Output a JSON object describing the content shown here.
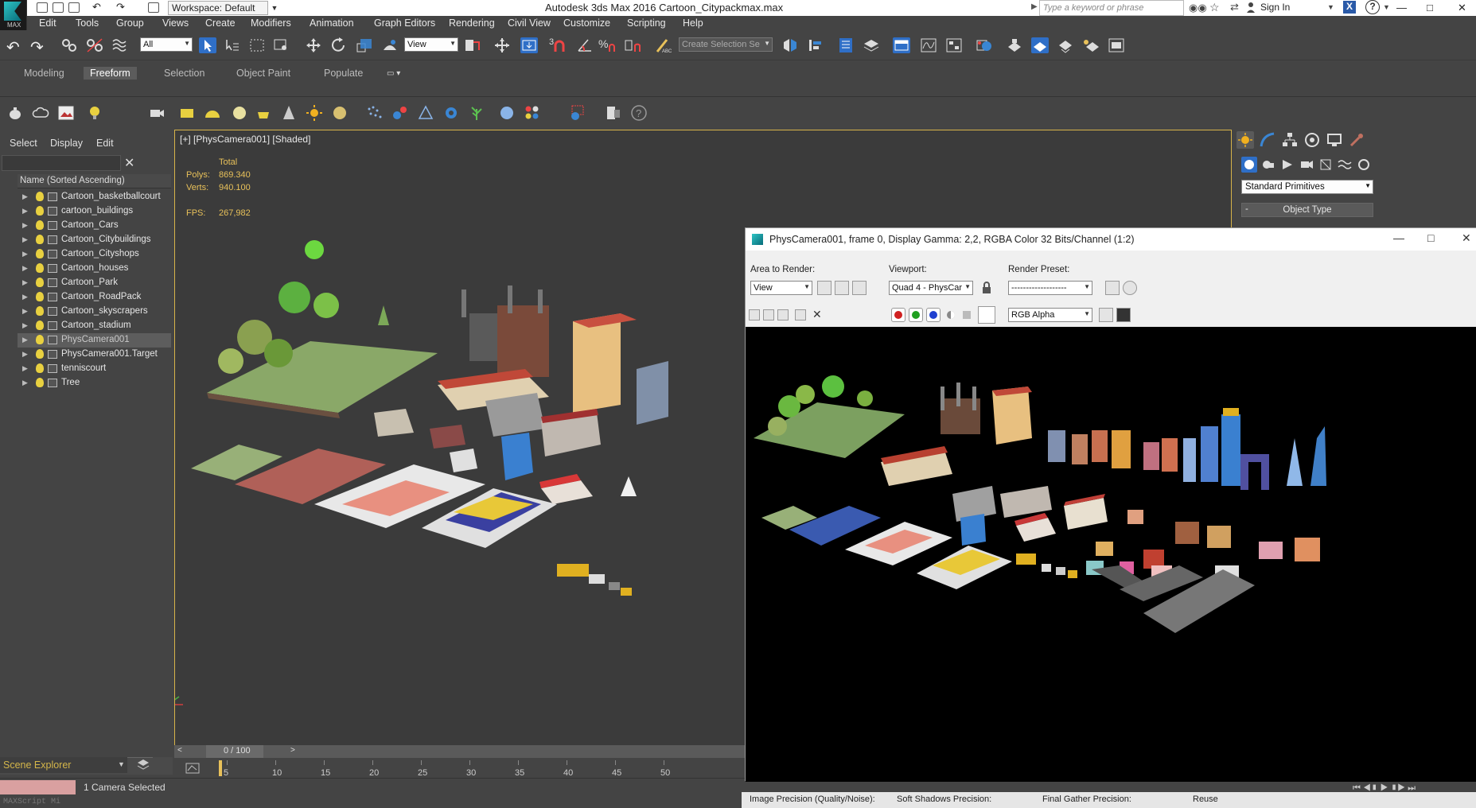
{
  "window": {
    "title": "Autodesk 3ds Max 2016    Cartoon_Citypackmax.max",
    "workspace": "Workspace: Default",
    "search_placeholder": "Type a keyword or phrase",
    "sign_in": "Sign In",
    "logo_text": "MAX"
  },
  "menu": [
    "Edit",
    "Tools",
    "Group",
    "Views",
    "Create",
    "Modifiers",
    "Animation",
    "Graph Editors",
    "Rendering",
    "Civil View",
    "Customize",
    "Scripting",
    "Help"
  ],
  "toolbar": {
    "selection_filter": "All",
    "reference_coord": "View",
    "named_selection": "Create Selection Se"
  },
  "ribbon_tabs": [
    {
      "label": "Modeling",
      "active": false
    },
    {
      "label": "Freeform",
      "active": true
    },
    {
      "label": "Selection",
      "active": false
    },
    {
      "label": "Object Paint",
      "active": false
    },
    {
      "label": "Populate",
      "active": false
    }
  ],
  "scene_explorer": {
    "menus": [
      "Select",
      "Display",
      "Edit"
    ],
    "column_header": "Name (Sorted Ascending)",
    "items": [
      {
        "name": "Cartoon_basketballcourt",
        "type": "geo",
        "selected": false
      },
      {
        "name": "cartoon_buildings",
        "type": "geo",
        "selected": false
      },
      {
        "name": "Cartoon_Cars",
        "type": "geo",
        "selected": false
      },
      {
        "name": "Cartoon_Citybuildings",
        "type": "geo",
        "selected": false
      },
      {
        "name": "Cartoon_Cityshops",
        "type": "geo",
        "selected": false
      },
      {
        "name": "Cartoon_houses",
        "type": "geo",
        "selected": false
      },
      {
        "name": "Cartoon_Park",
        "type": "geo",
        "selected": false
      },
      {
        "name": "Cartoon_RoadPack",
        "type": "geo",
        "selected": false
      },
      {
        "name": "Cartoon_skyscrapers",
        "type": "geo",
        "selected": false
      },
      {
        "name": "Cartoon_stadium",
        "type": "geo",
        "selected": false
      },
      {
        "name": "PhysCamera001",
        "type": "camera",
        "selected": true
      },
      {
        "name": "PhysCamera001.Target",
        "type": "camera",
        "selected": false
      },
      {
        "name": "tenniscourt",
        "type": "geo",
        "selected": false
      },
      {
        "name": "Tree",
        "type": "geo",
        "selected": false
      }
    ],
    "footer_label": "Scene Explorer"
  },
  "viewport": {
    "label": "[+] [PhysCamera001] [Shaded]",
    "stats_header": "Total",
    "polys_label": "Polys:",
    "polys_value": "869.340",
    "verts_label": "Verts:",
    "verts_value": "940.100",
    "fps_label": "FPS:",
    "fps_value": "267,982"
  },
  "timeline": {
    "position": "0 / 100",
    "ticks": [
      "5",
      "10",
      "15",
      "20",
      "25",
      "30",
      "35",
      "40",
      "45",
      "50"
    ]
  },
  "status": {
    "selection": "1 Camera Selected",
    "maxscript": "MAXScript Mi"
  },
  "command_panel": {
    "category": "Standard Primitives",
    "section": "Object Type"
  },
  "render_window": {
    "title": "PhysCamera001, frame 0, Display Gamma: 2,2, RGBA Color 32 Bits/Channel (1:2)",
    "area_label": "Area to Render:",
    "area_value": "View",
    "viewport_label": "Viewport:",
    "viewport_value": "Quad 4 - PhysCar",
    "preset_label": "Render Preset:",
    "preset_value": "-------------------",
    "channel_value": "RGB Alpha",
    "footer": {
      "image_precision": "Image Precision (Quality/Noise):",
      "soft_shadows": "Soft Shadows Precision:",
      "final_gather": "Final Gather Precision:",
      "reuse": "Reuse"
    }
  },
  "colors": {
    "ui_bg": "#444444",
    "viewport_bg": "#3b3b3b",
    "viewport_border": "#d8b44a",
    "stats_text": "#e8c15a",
    "active_blue": "#2f6fc7",
    "render_bg": "#000000"
  }
}
